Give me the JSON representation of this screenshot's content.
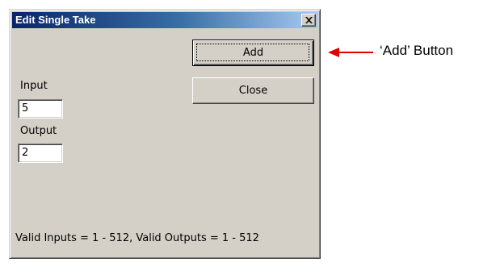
{
  "window": {
    "title": "Edit Single Take",
    "close_icon": "close-x-icon"
  },
  "buttons": {
    "add_label": "Add",
    "close_label": "Close"
  },
  "fields": {
    "input_label": "Input",
    "input_value": "5",
    "output_label": "Output",
    "output_value": "2"
  },
  "status": {
    "text": "Valid Inputs = 1 - 512, Valid Outputs = 1 - 512"
  },
  "annotation": {
    "text": "‘Add’ Button",
    "arrow_color": "#e00000",
    "icon": "left-arrow-icon"
  },
  "colors": {
    "dialog_face": "#d4d0c8",
    "title_start": "#0a246a",
    "title_end": "#a6caf0"
  }
}
